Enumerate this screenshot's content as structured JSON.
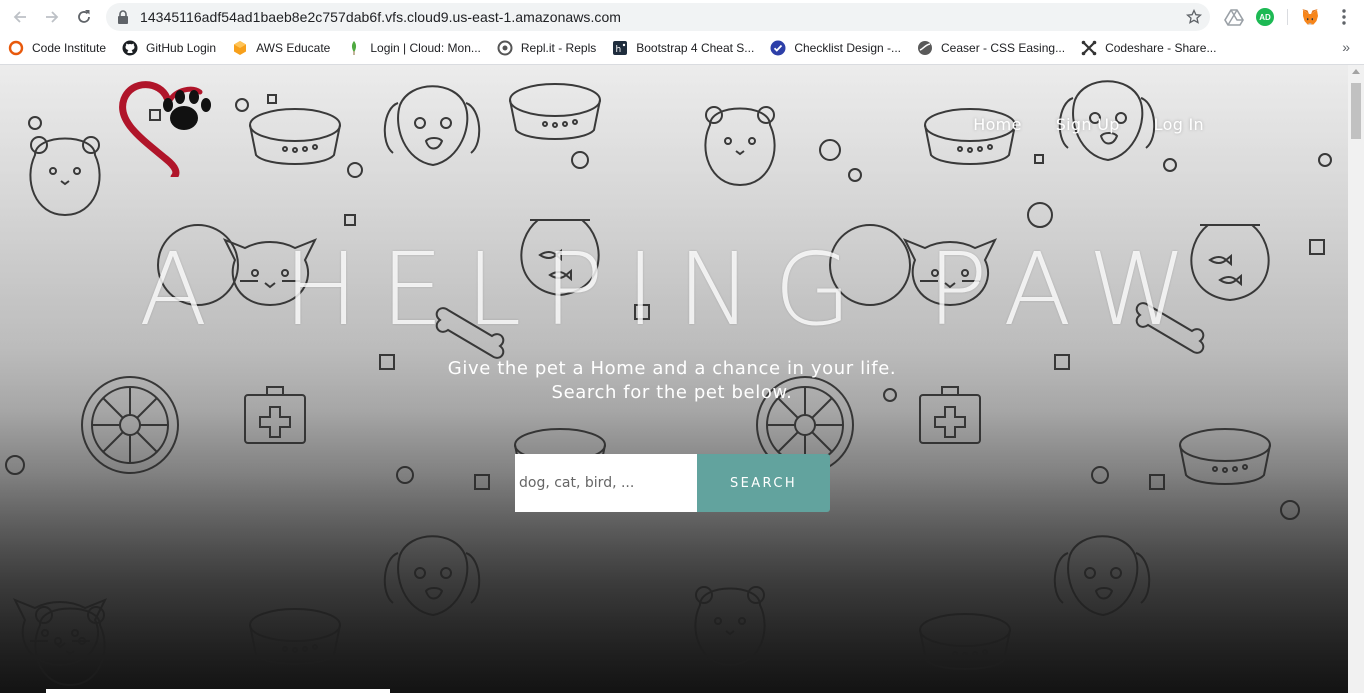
{
  "browser": {
    "url": "14345116adf54ad1baeb8e2c757dab6f.vfs.cloud9.us-east-1.amazonaws.com",
    "profile_badge": "AD",
    "bookmarks": [
      {
        "label": "Code Institute",
        "icon": "code-institute-icon"
      },
      {
        "label": "GitHub Login",
        "icon": "github-icon"
      },
      {
        "label": "AWS Educate",
        "icon": "aws-educate-icon"
      },
      {
        "label": "Login | Cloud: Mon...",
        "icon": "mongodb-leaf-icon"
      },
      {
        "label": "Repl.it - Repls",
        "icon": "replit-icon"
      },
      {
        "label": "Bootstrap 4 Cheat S...",
        "icon": "bootstrap-cheatsheet-icon"
      },
      {
        "label": "Checklist Design -...",
        "icon": "checklist-icon"
      },
      {
        "label": "Ceaser - CSS Easing...",
        "icon": "ceaser-icon"
      },
      {
        "label": "Codeshare - Share...",
        "icon": "codeshare-icon"
      }
    ],
    "more_bookmarks": "»"
  },
  "site": {
    "nav": [
      {
        "label": "Home"
      },
      {
        "label": "Sign Up"
      },
      {
        "label": "Log In"
      }
    ],
    "hero_title": "A HELPING PAW",
    "tagline_line1": "Give the pet a Home and a chance in your life.",
    "tagline_line2": "Search for the pet below.",
    "search": {
      "placeholder": "dog, cat, bird, ...",
      "button_label": "SEARCH"
    }
  },
  "colors": {
    "accent": "#62a39e",
    "logo_heart": "#b0152a",
    "logo_paw": "#111111"
  }
}
